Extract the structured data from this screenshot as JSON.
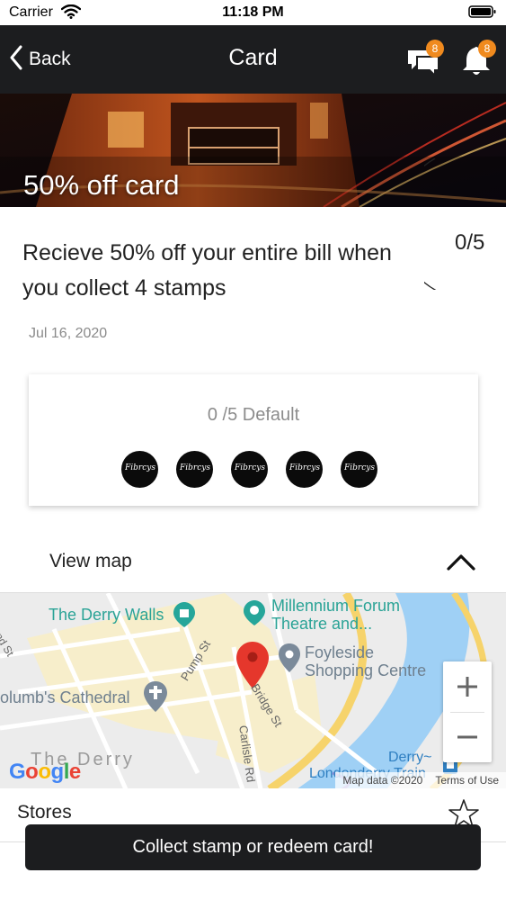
{
  "status_bar": {
    "carrier": "Carrier",
    "time": "11:18 PM"
  },
  "nav": {
    "back_label": "Back",
    "title": "Card",
    "messages_badge": "8",
    "notifications_badge": "8",
    "icons": [
      "chevron-left-icon",
      "chat-icon",
      "bell-icon"
    ]
  },
  "hero": {
    "title": "50% off card"
  },
  "card": {
    "progress": "0/5",
    "description": "Recieve 50% off your entire bill when you collect 4 stamps",
    "date": "Jul 16, 2020"
  },
  "stamp_card": {
    "label": "0 /5 Default",
    "stamps_total": 5,
    "stamps_collected": 0,
    "stamp_logo_text": "Fibrcys"
  },
  "map_section": {
    "toggle_label": "View map",
    "labels": {
      "derry_walls": "The Derry Walls",
      "millennium_1": "Millennium Forum",
      "millennium_2": "Theatre and...",
      "foyleside_1": "Foyleside",
      "foyleside_2": "Shopping Centre",
      "cathedral": "olumb's Cathedral",
      "pump_st": "Pump St",
      "bridge_st": "Bridge St",
      "carlisle_rd": "Carlisle Rd",
      "the_derry": "The Derry",
      "derry_station_1": "Derry~",
      "derry_station_2": "Londonderry Train",
      "land_st": "and St"
    },
    "google": "Google",
    "attribution": "Map data ©2020",
    "terms": "Terms of Use",
    "zoom_in": "+",
    "zoom_out": "−"
  },
  "stores": {
    "label": "Stores"
  },
  "toast": {
    "text": "Collect stamp or redeem card!"
  },
  "colors": {
    "nav_bg": "#1c1d1f",
    "badge": "#f08a1e",
    "map_pin": "#e5372c",
    "map_water": "#9fd0f5",
    "map_land": "#f7eecb",
    "map_highway": "#f6d36b"
  }
}
